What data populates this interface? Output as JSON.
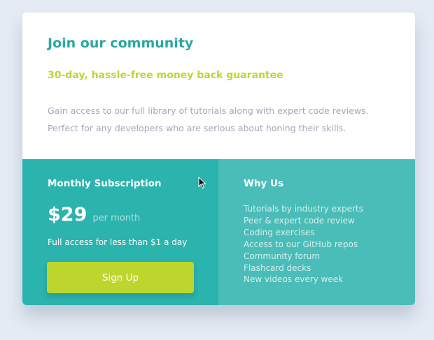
{
  "header": {
    "title": "Join our community",
    "guarantee": "30-day, hassle-free money back guarantee",
    "description_lines": [
      "Gain access to our full library of tutorials along with expert code reviews.",
      "Perfect for any developers who are serious about honing their skills."
    ]
  },
  "subscription": {
    "title": "Monthly Subscription",
    "price": "$29",
    "period": "per month",
    "note": "Full access for less than $1 a day",
    "signup_label": "Sign Up"
  },
  "why_us": {
    "title": "Why Us",
    "items": [
      "Tutorials by industry experts",
      "Peer & expert code review",
      "Coding exercises",
      "Access to our GitHub repos",
      "Community forum",
      "Flashcard decks",
      "New videos every week"
    ]
  },
  "colors": {
    "page_background": "#e4ebf5",
    "title": "#2aa8a3",
    "guarantee": "#bdd630",
    "description": "#a3a8b8",
    "subscription_panel": "#2bb3ad",
    "why_us_panel": "#4bbdb8",
    "signup_button": "#bdd62e"
  },
  "icons": {
    "cursor": "mouse-pointer-icon"
  }
}
